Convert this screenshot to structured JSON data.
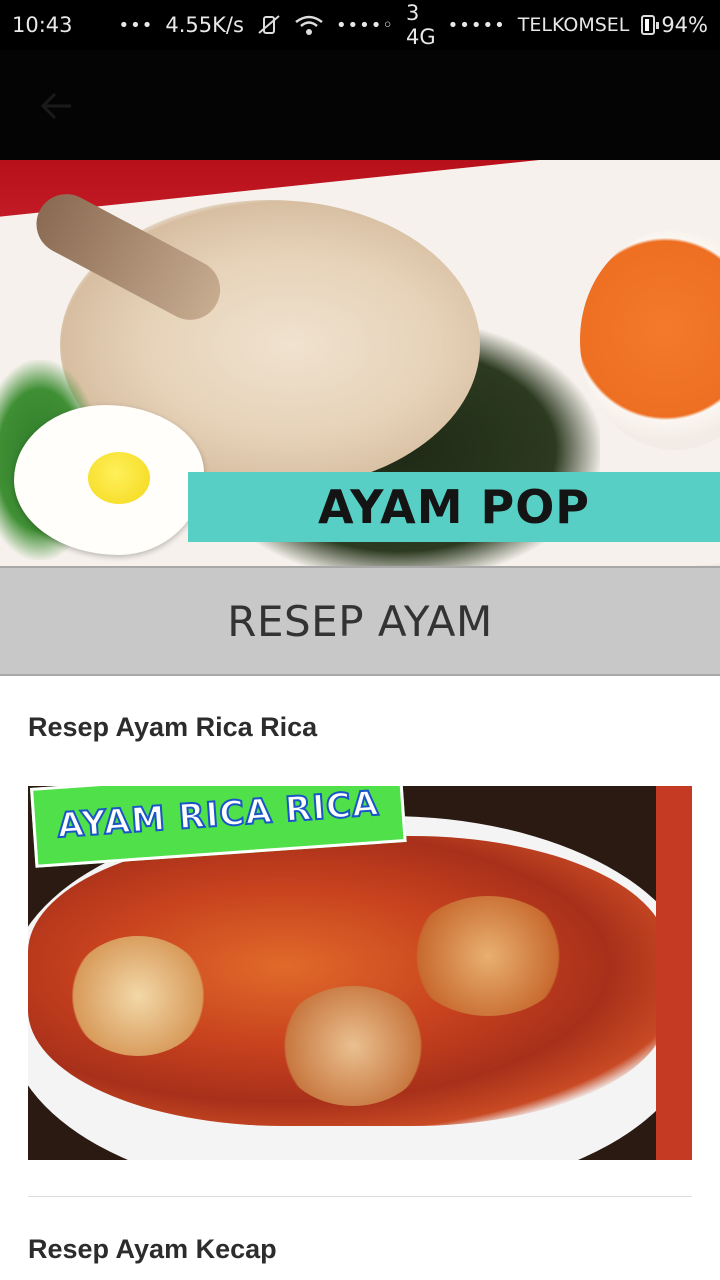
{
  "status_bar": {
    "time": "10:43",
    "overflow_dots": "•••",
    "net_speed": "4.55K/s",
    "signal_dots_1": "••••◦",
    "network_type": "3 4G",
    "signal_dots_2": "•••••",
    "carrier": "TELKOMSEL",
    "battery": "94%"
  },
  "app_bar": {
    "back_icon": "arrow-left-icon"
  },
  "hero": {
    "banner_text": "AYAM POP"
  },
  "section": {
    "title": "RESEP AYAM"
  },
  "recipes": [
    {
      "title": "Resep Ayam Rica Rica",
      "image_label": "AYAM RICA RICA"
    },
    {
      "title": "Resep Ayam Kecap"
    }
  ],
  "colors": {
    "app_bar_bg": "#040404",
    "section_header_bg": "#c8c8c8",
    "hero_banner": "#58cfc4",
    "rica_label": "#4fe04a"
  }
}
